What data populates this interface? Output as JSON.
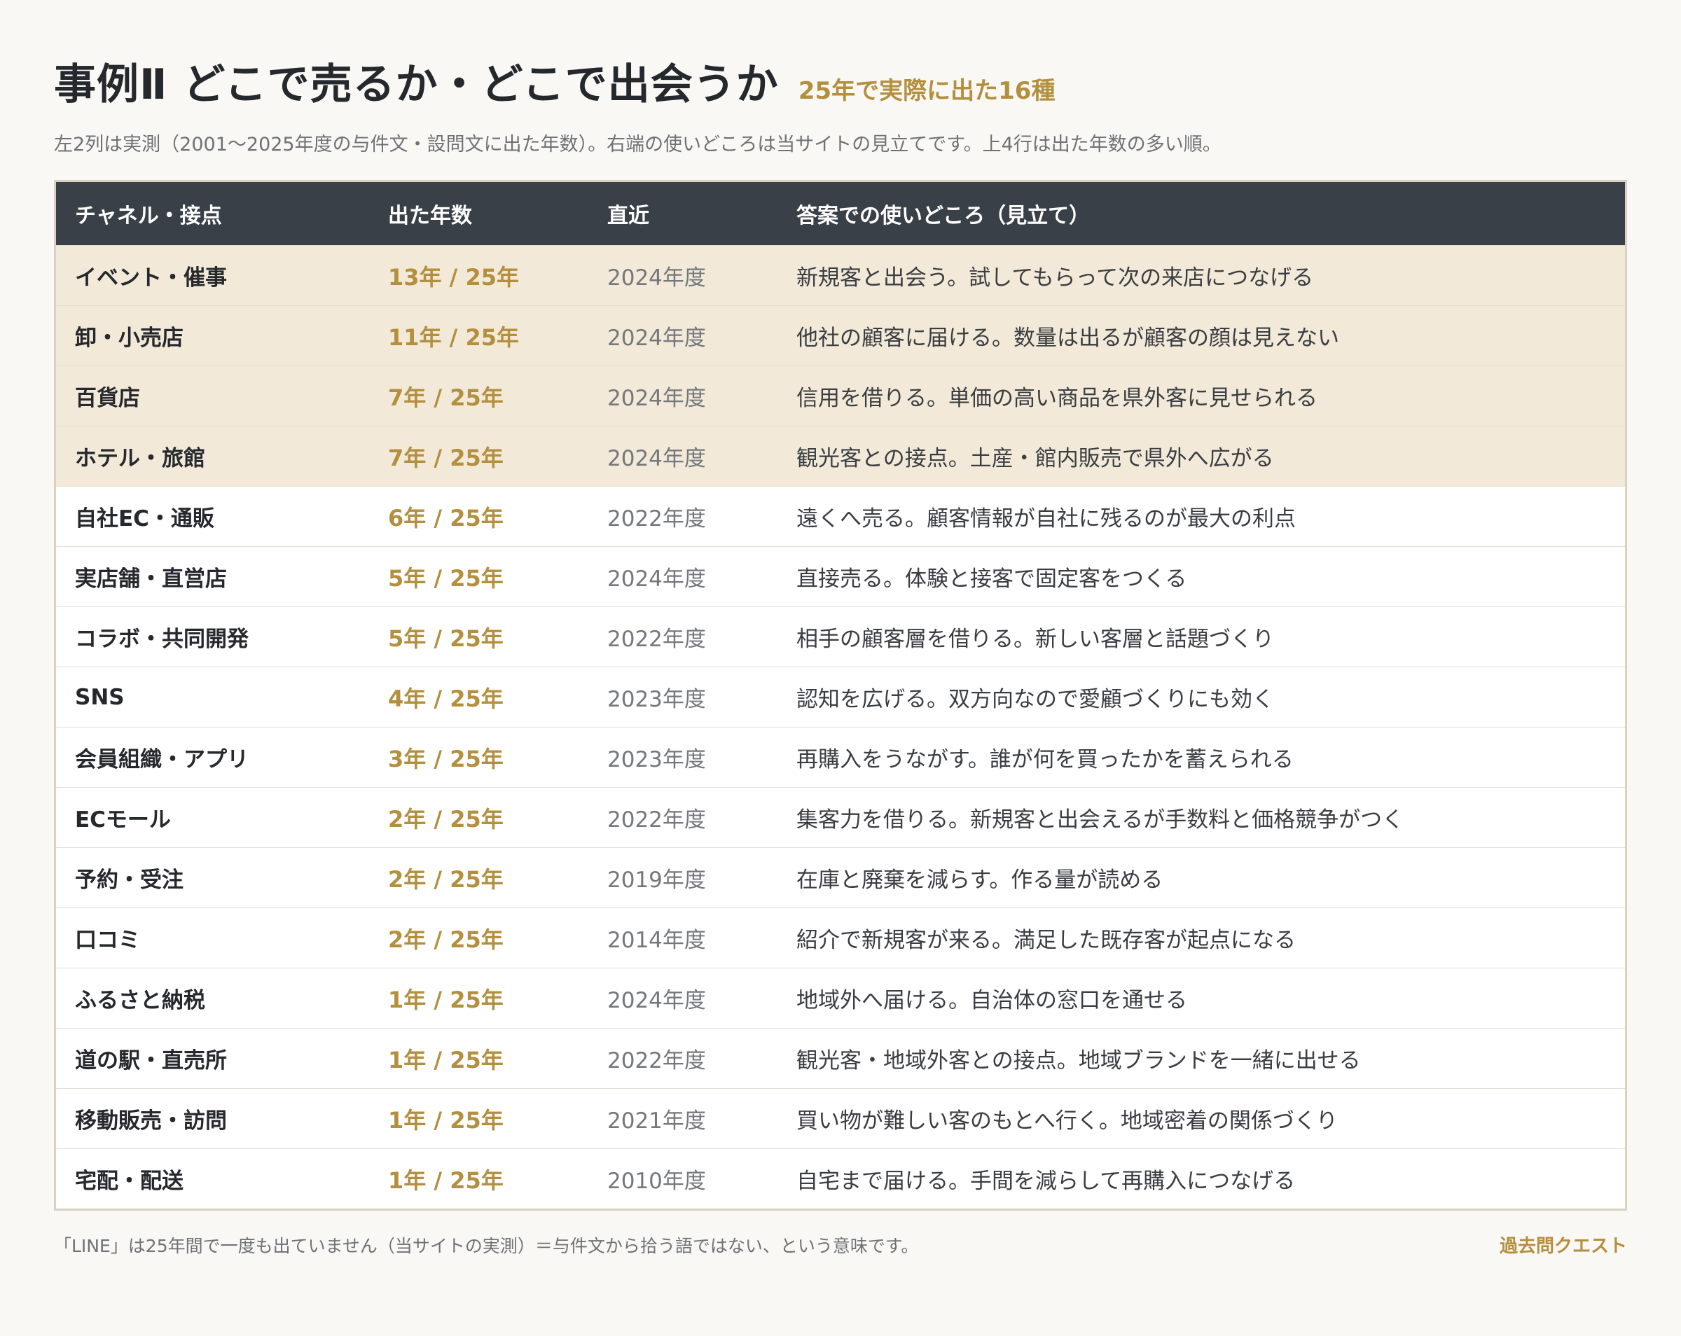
{
  "header": {
    "title": "事例Ⅱ どこで売るか・どこで出会うか",
    "subtitle": "25年で実際に出た16種",
    "description": "左2列は実測（2001〜2025年度の与件文・設問文に出た年数）。右端の使いどころは当サイトの見立てです。上4行は出た年数の多い順。"
  },
  "table": {
    "columns": [
      "チャネル・接点",
      "出た年数",
      "直近",
      "答案での使いどころ（見立て）"
    ],
    "rows": [
      {
        "channel": "イベント・催事",
        "count": "13年 / 25年",
        "recent": "2024年度",
        "usage": "新規客と出会う。試してもらって次の来店につなげる",
        "highlight": true
      },
      {
        "channel": "卸・小売店",
        "count": "11年 / 25年",
        "recent": "2024年度",
        "usage": "他社の顧客に届ける。数量は出るが顧客の顔は見えない",
        "highlight": true
      },
      {
        "channel": "百貨店",
        "count": "7年 / 25年",
        "recent": "2024年度",
        "usage": "信用を借りる。単価の高い商品を県外客に見せられる",
        "highlight": true
      },
      {
        "channel": "ホテル・旅館",
        "count": "7年 / 25年",
        "recent": "2024年度",
        "usage": "観光客との接点。土産・館内販売で県外へ広がる",
        "highlight": true
      },
      {
        "channel": "自社EC・通販",
        "count": "6年 / 25年",
        "recent": "2022年度",
        "usage": "遠くへ売る。顧客情報が自社に残るのが最大の利点",
        "highlight": false
      },
      {
        "channel": "実店舗・直営店",
        "count": "5年 / 25年",
        "recent": "2024年度",
        "usage": "直接売る。体験と接客で固定客をつくる",
        "highlight": false
      },
      {
        "channel": "コラボ・共同開発",
        "count": "5年 / 25年",
        "recent": "2022年度",
        "usage": "相手の顧客層を借りる。新しい客層と話題づくり",
        "highlight": false
      },
      {
        "channel": "SNS",
        "count": "4年 / 25年",
        "recent": "2023年度",
        "usage": "認知を広げる。双方向なので愛顧づくりにも効く",
        "highlight": false
      },
      {
        "channel": "会員組織・アプリ",
        "count": "3年 / 25年",
        "recent": "2023年度",
        "usage": "再購入をうながす。誰が何を買ったかを蓄えられる",
        "highlight": false
      },
      {
        "channel": "ECモール",
        "count": "2年 / 25年",
        "recent": "2022年度",
        "usage": "集客力を借りる。新規客と出会えるが手数料と価格競争がつく",
        "highlight": false
      },
      {
        "channel": "予約・受注",
        "count": "2年 / 25年",
        "recent": "2019年度",
        "usage": "在庫と廃棄を減らす。作る量が読める",
        "highlight": false
      },
      {
        "channel": "口コミ",
        "count": "2年 / 25年",
        "recent": "2014年度",
        "usage": "紹介で新規客が来る。満足した既存客が起点になる",
        "highlight": false
      },
      {
        "channel": "ふるさと納税",
        "count": "1年 / 25年",
        "recent": "2024年度",
        "usage": "地域外へ届ける。自治体の窓口を通せる",
        "highlight": false
      },
      {
        "channel": "道の駅・直売所",
        "count": "1年 / 25年",
        "recent": "2022年度",
        "usage": "観光客・地域外客との接点。地域ブランドを一緒に出せる",
        "highlight": false
      },
      {
        "channel": "移動販売・訪問",
        "count": "1年 / 25年",
        "recent": "2021年度",
        "usage": "買い物が難しい客のもとへ行く。地域密着の関係づくり",
        "highlight": false
      },
      {
        "channel": "宅配・配送",
        "count": "1年 / 25年",
        "recent": "2010年度",
        "usage": "自宅まで届ける。手間を減らして再購入につなげる",
        "highlight": false
      }
    ]
  },
  "footer": {
    "note": "「LINE」は25年間で一度も出ていません（当サイトの実測）＝与件文から拾う語ではない、という意味です。",
    "brand": "過去問クエスト"
  },
  "colors": {
    "accent": "#b38f3e",
    "header_bg": "#3a4048",
    "highlight_bg": "#f2e9d8",
    "page_bg": "#f9f8f5"
  }
}
